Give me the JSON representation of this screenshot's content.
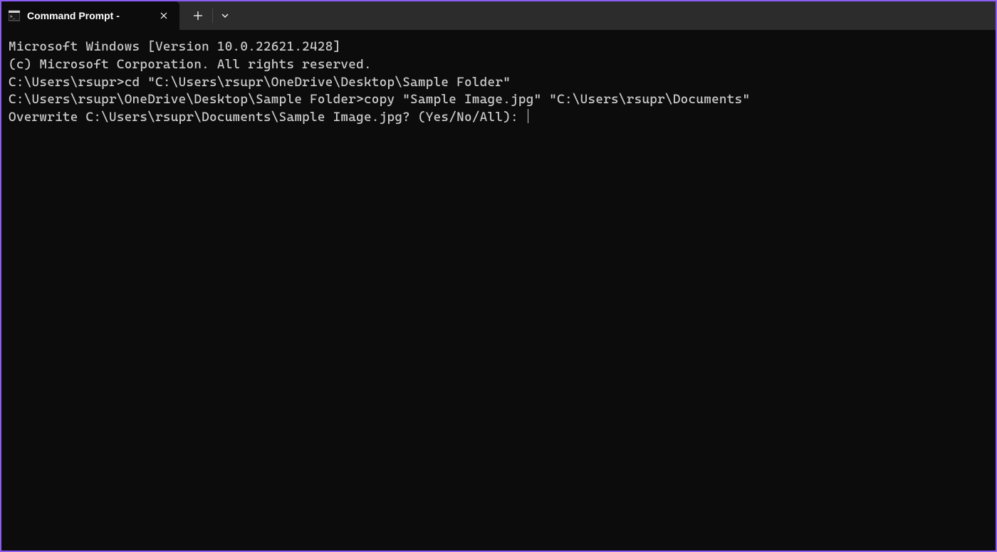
{
  "tab": {
    "title": "Command Prompt -"
  },
  "terminal": {
    "line1": "Microsoft Windows [Version 10.0.22621.2428]",
    "line2": "(c) Microsoft Corporation. All rights reserved.",
    "line3": "",
    "line4": "C:\\Users\\rsupr>cd \"C:\\Users\\rsupr\\OneDrive\\Desktop\\Sample Folder\"",
    "line5": "",
    "line6": "C:\\Users\\rsupr\\OneDrive\\Desktop\\Sample Folder>copy \"Sample Image.jpg\" \"C:\\Users\\rsupr\\Documents\"",
    "line7": "Overwrite C:\\Users\\rsupr\\Documents\\Sample Image.jpg? (Yes/No/All): "
  }
}
